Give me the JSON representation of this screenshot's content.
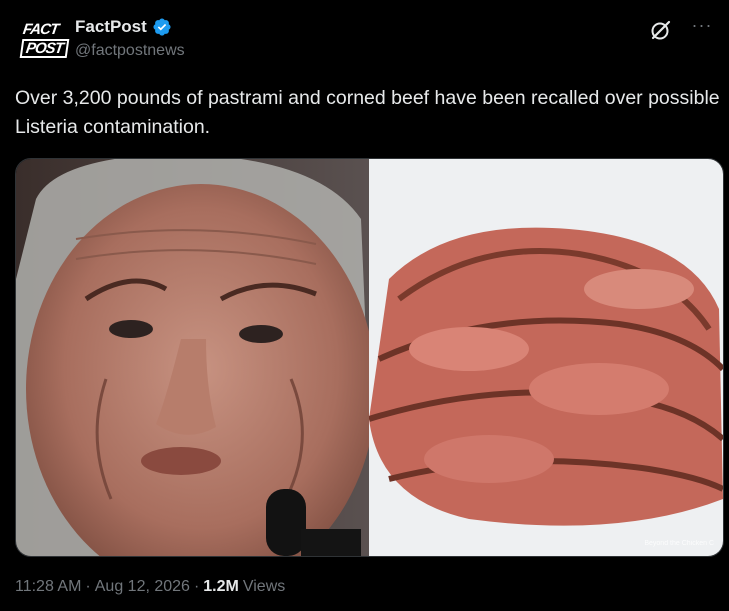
{
  "post": {
    "display_name": "FactPost",
    "handle": "@factpostnews",
    "avatar_line1": "FACT",
    "avatar_line2": "POST",
    "text": "Over 3,200 pounds of pastrami and corned beef have been recalled over possible Listeria contamination.",
    "time": "11:28 AM",
    "separator": "·",
    "date": "Aug 12, 2026",
    "separator2": "·",
    "views_count": "1.2M",
    "views_label": "Views",
    "watermark": "Beyond the Chicken C"
  },
  "colors": {
    "background": "#000000",
    "text": "#e7e9ea",
    "secondary": "#71767b",
    "verified": "#1d9bf0"
  }
}
